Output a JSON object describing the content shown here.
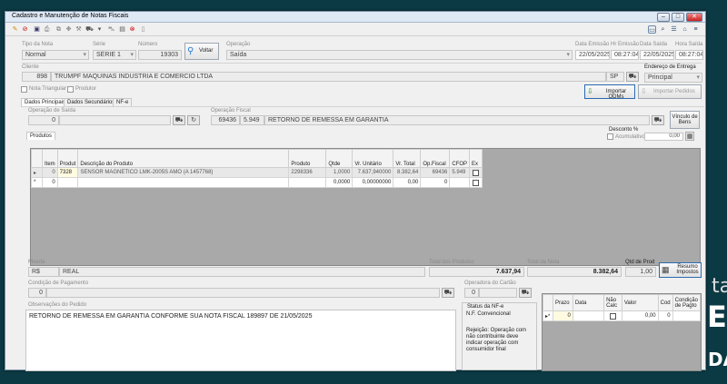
{
  "background": {
    "partial_text_1": "ta",
    "partial_text_2": "ER",
    "partial_text_3": "DAT"
  },
  "window": {
    "title": "Cadastro e Manutenção de Notas Fiscais",
    "minimize": "–",
    "maximize": "□",
    "close": "✕"
  },
  "header": {
    "tipo_label": "Tipo da Nota",
    "tipo_value": "Normal",
    "serie_label": "Série",
    "serie_value": "SÉRIE 1",
    "numero_label": "Número",
    "numero_value": "19303",
    "voltar_label": "Voltar",
    "operacao_label": "Operação",
    "operacao_value": "Saída",
    "data_emissao_label": "Data Emissão",
    "data_emissao_value": "22/05/2025",
    "hr_emissao_label": "Hr Emissão",
    "hr_emissao_value": "08:27:04",
    "data_saida_label": "Data Saída",
    "data_saida_value": "22/05/2025",
    "hora_saida_label": "Hora Saída",
    "hora_saida_value": "08:27:04"
  },
  "cliente": {
    "label": "Cliente",
    "code": "898",
    "name": "TRUMPF MAQUINAS INDUSTRIA E COMERCIO LTDA",
    "uf": "SP",
    "endereco_label": "Endereço de Entrega",
    "endereco_value": "Principal"
  },
  "flags": {
    "nota_triangular": "Nota Triangular",
    "produtor": "Produtor"
  },
  "actions": {
    "importar_odms": "Importar ODMs",
    "importar_pedidos": "Importar Pedidos"
  },
  "tabs": [
    "Dados Principais",
    "Dados Secundários",
    "NF-e"
  ],
  "operacao_saida": {
    "label": "Operação de Saída",
    "value": "0"
  },
  "operacao_fiscal": {
    "label": "Operação Fiscal",
    "code": "69436",
    "cfop": "5.949",
    "desc": "RETORNO DE REMESSA EM GARANTIA"
  },
  "vinculo": "Vínculo de Bens",
  "desconto": {
    "label": "Desconto %",
    "acumulativo": "Acumulativo",
    "value": "0,00"
  },
  "produtos_tab": "Produtos",
  "items": {
    "columns": [
      "Item",
      "Produt",
      "Descrição do Produto",
      "Produto",
      "Qtde",
      "Vr. Unitário",
      "Vr. Total",
      "Op.Fiscal",
      "CFOP",
      "Ex"
    ],
    "rows": [
      {
        "marker": "▸",
        "item": "0",
        "produt": "7328",
        "desc": "SENSOR MAGNETICO LMK-2005S AMO (A 1457768)",
        "produto": "2298336",
        "qtde": "1,0000",
        "unit": "7.637,940000",
        "total": "8.382,64",
        "opfiscal": "69436",
        "cfop": "5.949"
      },
      {
        "marker": "*",
        "item": "0",
        "produt": "",
        "desc": "",
        "produto": "",
        "qtde": "0,0000",
        "unit": "0,00000000",
        "total": "0,00",
        "opfiscal": "0",
        "cfop": ""
      }
    ]
  },
  "totals": {
    "moeda_label": "Moeda",
    "moeda_symbol": "R$",
    "moeda_name": "REAL",
    "total_produtos_label": "Total dos Produtos",
    "total_produtos": "7.637,94",
    "total_nota_label": "Total da Nota",
    "total_nota": "8.382,64",
    "qtd_prod_label": "Qtd de Prod",
    "qtd_prod": "1,00",
    "resumo": "Resumo Impostos"
  },
  "pagamento": {
    "label": "Condição de Pagamento",
    "value": "0"
  },
  "cartao": {
    "label": "Operadora do Cartão",
    "value": "0"
  },
  "observacoes": {
    "label": "Observações do Pedido",
    "value": "RETORNO DE REMESSA EM GARANTIA CONFORME SUA NOTA FISCAL 189897 DE 21/05/2025"
  },
  "status_nfe": {
    "label": "Status da NF-e",
    "type": "N.F. Convencional",
    "message": "Rejeição: Operação com não contribuinte deve indicar operação com consumidor final"
  },
  "parcelas": {
    "columns": [
      "Prazo",
      "Data",
      "Não Calc",
      "Valor",
      "Cod",
      "Condição de Pagto"
    ],
    "rows": [
      {
        "marker": "▸*",
        "prazo": "0",
        "data": "",
        "valor": "0,00",
        "cod": "0",
        "cond": ""
      }
    ]
  },
  "colors": {
    "title_bg": "#dfe9f5",
    "grid_bg": "#a9a9a9",
    "desktop": "#0c3a44"
  }
}
